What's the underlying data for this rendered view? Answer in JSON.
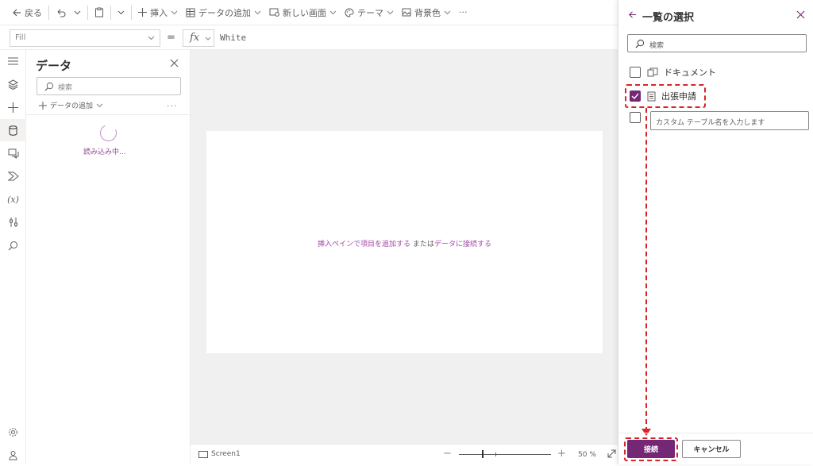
{
  "toolbar": {
    "back_label": "戻る",
    "insert_label": "挿入",
    "add_data_label": "データの追加",
    "new_screen_label": "新しい画面",
    "theme_label": "テーマ",
    "background_label": "背景色",
    "more_label": "···"
  },
  "formula": {
    "property": "Fill",
    "equals": "=",
    "fx": "fx",
    "value": "White"
  },
  "data_pane": {
    "title": "データ",
    "search_placeholder": "検索",
    "add_data": "データの追加",
    "more": "···",
    "loading": "読み込み中..."
  },
  "canvas": {
    "hint_link1": "挿入ペインで項目を追加する",
    "hint_mid": " または",
    "hint_link2": "データに接続する"
  },
  "status": {
    "screen_name": "Screen1",
    "zoom_minus": "−",
    "zoom_plus": "+",
    "zoom": "50 %"
  },
  "panel": {
    "title": "一覧の選択",
    "search_placeholder": "検索",
    "items": [
      {
        "label": "ドキュメント",
        "checked": false
      },
      {
        "label": "出張申請",
        "checked": true
      }
    ],
    "custom_placeholder": "カスタム テーブル名を入力します",
    "connect_label": "接続",
    "cancel_label": "キャンセル"
  },
  "colors": {
    "accent": "#742774",
    "annotation": "#d9232a",
    "canvas_bg": "#f0f0f0"
  }
}
